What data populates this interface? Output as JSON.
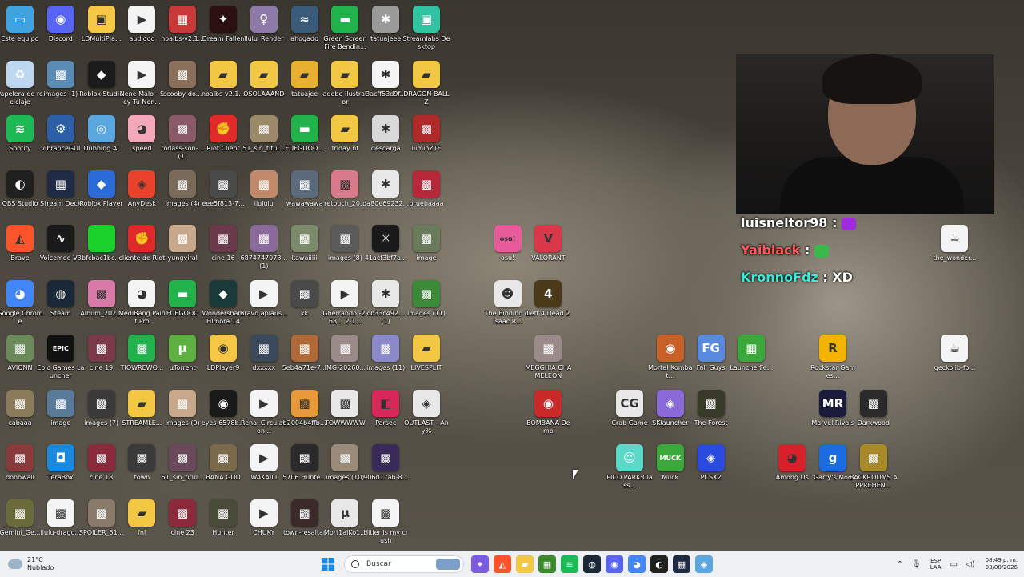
{
  "desktop_icons": [
    {
      "label": "Este equipo",
      "color": "#3fa3e0",
      "glyph": "▭",
      "col": 0,
      "row": 0
    },
    {
      "label": "Discord",
      "color": "#5865f2",
      "glyph": "◉",
      "col": 1,
      "row": 0
    },
    {
      "label": "LDMultiPla...",
      "color": "#f6c744",
      "glyph": "▣",
      "col": 2,
      "row": 0
    },
    {
      "label": "audiooo",
      "color": "#f4f4f4",
      "glyph": "▶",
      "col": 3,
      "row": 0
    },
    {
      "label": "noalbs-v2.1...",
      "color": "#c8393a",
      "glyph": "▦",
      "col": 4,
      "row": 0
    },
    {
      "label": "Dream Fallen",
      "color": "#2a1010",
      "glyph": "✦",
      "col": 5,
      "row": 0
    },
    {
      "label": "llulu_Render",
      "color": "#8e7aa8",
      "glyph": "♀",
      "col": 6,
      "row": 0
    },
    {
      "label": "ahogado",
      "color": "#3a5b7a",
      "glyph": "≈",
      "col": 7,
      "row": 0
    },
    {
      "label": "Green Screen Fire Bendin...",
      "color": "#22b24c",
      "glyph": "▬",
      "col": 8,
      "row": 0
    },
    {
      "label": "tatuajeee",
      "color": "#9a9a9a",
      "glyph": "✱",
      "col": 9,
      "row": 0
    },
    {
      "label": "Streamlabs Desktop",
      "color": "#31c3a2",
      "glyph": "▣",
      "col": 10,
      "row": 0
    },
    {
      "label": "Papelera de reciclaje",
      "color": "#bcd7ef",
      "glyph": "♻",
      "col": 0,
      "row": 1
    },
    {
      "label": "images (1)",
      "color": "#5a8bb5",
      "glyph": "▩",
      "col": 1,
      "row": 1
    },
    {
      "label": "Roblox Studio",
      "color": "#1b1b1b",
      "glyph": "◆",
      "col": 2,
      "row": 1
    },
    {
      "label": "Nene Malo - Sey Tu Nen...",
      "color": "#f4f4f4",
      "glyph": "▶",
      "col": 3,
      "row": 1
    },
    {
      "label": "scooby-do...",
      "color": "#8a6f5a",
      "glyph": "▩",
      "col": 4,
      "row": 1
    },
    {
      "label": "noalbs-v2.1...",
      "color": "#f2c744",
      "glyph": "▰",
      "col": 5,
      "row": 1
    },
    {
      "label": "OSOLAAAND",
      "color": "#f2c744",
      "glyph": "▰",
      "col": 6,
      "row": 1
    },
    {
      "label": "tatuajee",
      "color": "#e8b030",
      "glyph": "▰",
      "col": 7,
      "row": 1
    },
    {
      "label": "adobe ilustrator",
      "color": "#f2c744",
      "glyph": "▰",
      "col": 8,
      "row": 1
    },
    {
      "label": "3acff53d9f...",
      "color": "#f4f4f4",
      "glyph": "✱",
      "col": 9,
      "row": 1
    },
    {
      "label": "DRAGON BALL Z",
      "color": "#f2c744",
      "glyph": "▰",
      "col": 10,
      "row": 1
    },
    {
      "label": "Spotify",
      "color": "#1db954",
      "glyph": "≋",
      "col": 0,
      "row": 2
    },
    {
      "label": "vibranceGUI",
      "color": "#2d5fa8",
      "glyph": "⚙",
      "col": 1,
      "row": 2
    },
    {
      "label": "Dubbing AI",
      "color": "#5aa7e0",
      "glyph": "◎",
      "col": 2,
      "row": 2
    },
    {
      "label": "speed",
      "color": "#f2a8b8",
      "glyph": "◕",
      "col": 3,
      "row": 2
    },
    {
      "label": "todass-son-... (1)",
      "color": "#8a5a6a",
      "glyph": "▩",
      "col": 4,
      "row": 2
    },
    {
      "label": "Riot Client",
      "color": "#e02a2a",
      "glyph": "✊",
      "col": 5,
      "row": 2
    },
    {
      "label": "51_sin_titul...",
      "color": "#9a8a6a",
      "glyph": "▩",
      "col": 6,
      "row": 2
    },
    {
      "label": "FUEGOOO...",
      "color": "#22b24c",
      "glyph": "▬",
      "col": 7,
      "row": 2
    },
    {
      "label": "friday nf",
      "color": "#f2c744",
      "glyph": "▰",
      "col": 8,
      "row": 2
    },
    {
      "label": "descarga",
      "color": "#d8d8d8",
      "glyph": "✱",
      "col": 9,
      "row": 2
    },
    {
      "label": "iiiminZTF",
      "color": "#b02a2a",
      "glyph": "▩",
      "col": 10,
      "row": 2
    },
    {
      "label": "OBS Studio",
      "color": "#202020",
      "glyph": "◐",
      "col": 0,
      "row": 3
    },
    {
      "label": "Stream Deck",
      "color": "#1f2a44",
      "glyph": "▦",
      "col": 1,
      "row": 3
    },
    {
      "label": "Roblox Player",
      "color": "#2a6bd8",
      "glyph": "◆",
      "col": 2,
      "row": 3
    },
    {
      "label": "AnyDesk",
      "color": "#e8412c",
      "glyph": "◈",
      "col": 3,
      "row": 3
    },
    {
      "label": "images (4)",
      "color": "#7a6a5a",
      "glyph": "▩",
      "col": 4,
      "row": 3
    },
    {
      "label": "eee5f813-7...",
      "color": "#4a4a4a",
      "glyph": "▩",
      "col": 5,
      "row": 3
    },
    {
      "label": "ilululu",
      "color": "#c08a6a",
      "glyph": "▩",
      "col": 6,
      "row": 3
    },
    {
      "label": "wawawawa",
      "color": "#5a6a7a",
      "glyph": "▩",
      "col": 7,
      "row": 3
    },
    {
      "label": "retouch_20...",
      "color": "#d87a8a",
      "glyph": "▩",
      "col": 8,
      "row": 3
    },
    {
      "label": "da80e69232...",
      "color": "#e8e8e8",
      "glyph": "✱",
      "col": 9,
      "row": 3
    },
    {
      "label": "pruebaaaa",
      "color": "#b8283a",
      "glyph": "▩",
      "col": 10,
      "row": 3
    },
    {
      "label": "Brave",
      "color": "#fb542b",
      "glyph": "◭",
      "col": 0,
      "row": 4
    },
    {
      "label": "Voicemod V3",
      "color": "#1a1a1a",
      "glyph": "∿",
      "col": 1,
      "row": 4
    },
    {
      "label": "bfcbac1bc...",
      "color": "#19d12a",
      "glyph": "",
      "col": 2,
      "row": 4
    },
    {
      "label": "cliente de Riot",
      "color": "#e02a2a",
      "glyph": "✊",
      "col": 3,
      "row": 4
    },
    {
      "label": "yungviral",
      "color": "#c8a88a",
      "glyph": "▩",
      "col": 4,
      "row": 4
    },
    {
      "label": "cine 16",
      "color": "#6a3a4a",
      "glyph": "▩",
      "col": 5,
      "row": 4
    },
    {
      "label": "6874747073... (1)",
      "color": "#8a6a9a",
      "glyph": "▩",
      "col": 6,
      "row": 4
    },
    {
      "label": "kawaiiiii",
      "color": "#7a8a6a",
      "glyph": "▩",
      "col": 7,
      "row": 4
    },
    {
      "label": "images (8)",
      "color": "#5a5a5a",
      "glyph": "▩",
      "col": 8,
      "row": 4
    },
    {
      "label": "41acf3bf7a...",
      "color": "#1a1a1a",
      "glyph": "✳",
      "col": 9,
      "row": 4
    },
    {
      "label": "image",
      "color": "#6a7a5a",
      "glyph": "▩",
      "col": 10,
      "row": 4
    },
    {
      "label": "Google Chrome",
      "color": "#4285f4",
      "glyph": "◕",
      "col": 0,
      "row": 5
    },
    {
      "label": "Steam",
      "color": "#1b2838",
      "glyph": "◍",
      "col": 1,
      "row": 5
    },
    {
      "label": "Album_202...",
      "color": "#d87aa8",
      "glyph": "▩",
      "col": 2,
      "row": 5
    },
    {
      "label": "MediBang Paint Pro",
      "color": "#f4f4f4",
      "glyph": "◕",
      "col": 3,
      "row": 5
    },
    {
      "label": "FUEGOOO",
      "color": "#22b24c",
      "glyph": "▬",
      "col": 4,
      "row": 5
    },
    {
      "label": "Wondershare Filmora 14",
      "color": "#1a3a3a",
      "glyph": "◆",
      "col": 5,
      "row": 5
    },
    {
      "label": "Bravo aplaus...",
      "color": "#f4f4f4",
      "glyph": "▶",
      "col": 6,
      "row": 5
    },
    {
      "label": "kk",
      "color": "#4a4a4a",
      "glyph": "▩",
      "col": 7,
      "row": 5
    },
    {
      "label": "Gherrando -2-68... 2-1...",
      "color": "#f4f4f4",
      "glyph": "▶",
      "col": 8,
      "row": 5
    },
    {
      "label": "cb33c492... (1)",
      "color": "#e8e8e8",
      "glyph": "✱",
      "col": 9,
      "row": 5
    },
    {
      "label": "images (11)",
      "color": "#3a8a3a",
      "glyph": "▩",
      "col": 10,
      "row": 5
    },
    {
      "label": "AVIONN",
      "color": "#6a8a5a",
      "glyph": "▩",
      "col": 0,
      "row": 6
    },
    {
      "label": "Epic Games Launcher",
      "color": "#111111",
      "glyph": "EPIC",
      "col": 1,
      "row": 6
    },
    {
      "label": "cine 19",
      "color": "#7a3a4a",
      "glyph": "▩",
      "col": 2,
      "row": 6
    },
    {
      "label": "TIOWREWO...",
      "color": "#22b24c",
      "glyph": "▩",
      "col": 3,
      "row": 6
    },
    {
      "label": "µTorrent",
      "color": "#5fb043",
      "glyph": "µ",
      "col": 4,
      "row": 6
    },
    {
      "label": "LDPlayer9",
      "color": "#f6c744",
      "glyph": "◉",
      "col": 5,
      "row": 6
    },
    {
      "label": "dxxxxx",
      "color": "#3a4a5a",
      "glyph": "▩",
      "col": 6,
      "row": 6
    },
    {
      "label": "5eb4a71e-7...",
      "color": "#b06a3a",
      "glyph": "▩",
      "col": 7,
      "row": 6
    },
    {
      "label": "IMG-20260...",
      "color": "#9a8a8a",
      "glyph": "▩",
      "col": 8,
      "row": 6
    },
    {
      "label": "images (11)",
      "color": "#8a8aca",
      "glyph": "▩",
      "col": 9,
      "row": 6
    },
    {
      "label": "LIVESPLIT",
      "color": "#f2c744",
      "glyph": "▰",
      "col": 10,
      "row": 6
    },
    {
      "label": "cabaaa",
      "color": "#8a7a5a",
      "glyph": "▩",
      "col": 0,
      "row": 7
    },
    {
      "label": "image",
      "color": "#5a7a9a",
      "glyph": "▩",
      "col": 1,
      "row": 7
    },
    {
      "label": "images (7)",
      "color": "#3a3a3a",
      "glyph": "▩",
      "col": 2,
      "row": 7
    },
    {
      "label": "STREAMLE...",
      "color": "#f2c744",
      "glyph": "▰",
      "col": 3,
      "row": 7
    },
    {
      "label": "images (9)",
      "color": "#c8a88a",
      "glyph": "▩",
      "col": 4,
      "row": 7
    },
    {
      "label": "eyes-6578b...",
      "color": "#1a1a1a",
      "glyph": "◉",
      "col": 5,
      "row": 7
    },
    {
      "label": "Renai Circulation...",
      "color": "#f4f4f4",
      "glyph": "▶",
      "col": 6,
      "row": 7
    },
    {
      "label": "d2004b4ffb...",
      "color": "#e89a3a",
      "glyph": "▩",
      "col": 7,
      "row": 7
    },
    {
      "label": "TOWWWWW",
      "color": "#e8e8e8",
      "glyph": "▩",
      "col": 8,
      "row": 7
    },
    {
      "label": "Parsec",
      "color": "#d8285a",
      "glyph": "◧",
      "col": 9,
      "row": 7
    },
    {
      "label": "OUTLAST - Any%",
      "color": "#e8e8e8",
      "glyph": "◈",
      "col": 10,
      "row": 7
    },
    {
      "label": "donowall",
      "color": "#8a3a3a",
      "glyph": "▩",
      "col": 0,
      "row": 8
    },
    {
      "label": "TeraBox",
      "color": "#1a8ae0",
      "glyph": "◘",
      "col": 1,
      "row": 8
    },
    {
      "label": "cine 18",
      "color": "#8a2a3a",
      "glyph": "▩",
      "col": 2,
      "row": 8
    },
    {
      "label": "town",
      "color": "#3a3a3a",
      "glyph": "▩",
      "col": 3,
      "row": 8
    },
    {
      "label": "51_sin_titul...",
      "color": "#6a4a5a",
      "glyph": "▩",
      "col": 4,
      "row": 8
    },
    {
      "label": "BANA GOD",
      "color": "#7a6a4a",
      "glyph": "▩",
      "col": 5,
      "row": 8
    },
    {
      "label": "WAKAIIII",
      "color": "#f4f4f4",
      "glyph": "▶",
      "col": 6,
      "row": 8
    },
    {
      "label": "5706.Hunte...",
      "color": "#2a2a2a",
      "glyph": "▩",
      "col": 7,
      "row": 8
    },
    {
      "label": "images (10)",
      "color": "#9a8a7a",
      "glyph": "▩",
      "col": 8,
      "row": 8
    },
    {
      "label": "906d17ab-8...",
      "color": "#3a2a5a",
      "glyph": "▩",
      "col": 9,
      "row": 8
    },
    {
      "label": "Gemini_Ge...",
      "color": "#6a6a3a",
      "glyph": "▩",
      "col": 0,
      "row": 9
    },
    {
      "label": "ilulu-drago...",
      "color": "#f4f4f4",
      "glyph": "▩",
      "col": 1,
      "row": 9
    },
    {
      "label": "SPOILER_51...",
      "color": "#8a7a6a",
      "glyph": "▩",
      "col": 2,
      "row": 9
    },
    {
      "label": "fnf",
      "color": "#f2c744",
      "glyph": "▰",
      "col": 3,
      "row": 9
    },
    {
      "label": "cine 23",
      "color": "#8a2a3a",
      "glyph": "▩",
      "col": 4,
      "row": 9
    },
    {
      "label": "Hunter",
      "color": "#4a4a3a",
      "glyph": "▩",
      "col": 5,
      "row": 9
    },
    {
      "label": "CHUKY",
      "color": "#f4f4f4",
      "glyph": "▶",
      "col": 6,
      "row": 9
    },
    {
      "label": "town-resaltar",
      "color": "#3a2a2a",
      "glyph": "▩",
      "col": 7,
      "row": 9
    },
    {
      "label": "Mort1aiKo1...",
      "color": "#e8e8e8",
      "glyph": "µ",
      "col": 8,
      "row": 9
    },
    {
      "label": "Hitler is my crush",
      "color": "#f4f4f4",
      "glyph": "▩",
      "col": 9,
      "row": 9
    },
    {
      "label": "osu!",
      "color": "#e85b9a",
      "glyph": "osu!",
      "col": 12,
      "row": 4
    },
    {
      "label": "VALORANT",
      "color": "#d8384a",
      "glyph": "V",
      "col": 13,
      "row": 4
    },
    {
      "label": "The Binding of Isaac R...",
      "color": "#e8e8e8",
      "glyph": "☻",
      "col": 12,
      "row": 5
    },
    {
      "label": "Left 4 Dead 2",
      "color": "#4a3a1a",
      "glyph": "4",
      "col": 13,
      "row": 5
    },
    {
      "label": "MEGGHIA CHAMELEON",
      "color": "#9a8a8a",
      "glyph": "▩",
      "col": 13,
      "row": 6
    },
    {
      "label": "BOMBANA Demo",
      "color": "#c82a2a",
      "glyph": "◉",
      "col": 13,
      "row": 7
    },
    {
      "label": "Mortal Kombat...",
      "color": "#c8602a",
      "glyph": "◉",
      "col": 16,
      "row": 6
    },
    {
      "label": "Fall Guys",
      "color": "#5a8ae0",
      "glyph": "FG",
      "col": 17,
      "row": 6
    },
    {
      "label": "LauncherFe...",
      "color": "#3aa83a",
      "glyph": "▦",
      "col": 18,
      "row": 6
    },
    {
      "label": "Rockstar Games...",
      "color": "#f2b400",
      "glyph": "R",
      "col": 20,
      "row": 6
    },
    {
      "label": "geckolib-fo...",
      "color": "#f4f4f4",
      "glyph": "☕",
      "col": 23,
      "row": 6
    },
    {
      "label": "Crab Game",
      "color": "#e8e8e8",
      "glyph": "CG",
      "col": 15,
      "row": 7
    },
    {
      "label": "SKlauncher",
      "color": "#8a6ad8",
      "glyph": "◈",
      "col": 16,
      "row": 7
    },
    {
      "label": "The Forest",
      "color": "#3a3a2a",
      "glyph": "▩",
      "col": 17,
      "row": 7
    },
    {
      "label": "Marvel Rivals",
      "color": "#1a1a3a",
      "glyph": "MR",
      "col": 20,
      "row": 7
    },
    {
      "label": "Darkwood",
      "color": "#2a2a2a",
      "glyph": "▩",
      "col": 21,
      "row": 7
    },
    {
      "label": "PICO PARK:Class...",
      "color": "#5ad8c8",
      "glyph": "☺",
      "col": 15,
      "row": 8
    },
    {
      "label": "Muck",
      "color": "#3aa83a",
      "glyph": "MUCK",
      "col": 16,
      "row": 8
    },
    {
      "label": "PCSX2",
      "color": "#2a4ae0",
      "glyph": "◈",
      "col": 17,
      "row": 8
    },
    {
      "label": "Among Us",
      "color": "#d8202a",
      "glyph": "◕",
      "col": 19,
      "row": 8
    },
    {
      "label": "Garry's Mod",
      "color": "#1a6ae0",
      "glyph": "g",
      "col": 20,
      "row": 8
    },
    {
      "label": "BACKROOMS APPREHEN...",
      "color": "#a88a2a",
      "glyph": "▩",
      "col": 21,
      "row": 8
    },
    {
      "label": "the_wonder...",
      "color": "#f4f4f4",
      "glyph": "☕",
      "col": 23,
      "row": 4
    }
  ],
  "chat": [
    {
      "user": "luisneltor98",
      "message": "",
      "color": "#ffffff"
    },
    {
      "user": "Yaiblack",
      "message": "",
      "color": "#ff5a5a"
    },
    {
      "user": "KronnoFdz",
      "message": "XD",
      "color": "#3ae8d8"
    }
  ],
  "taskbar": {
    "weather_temp": "21°C",
    "weather_desc": "Nublado",
    "search_placeholder": "Buscar",
    "apps": [
      {
        "name": "copilot-icon",
        "color": "#7a5ae0",
        "glyph": "✦"
      },
      {
        "name": "brave-icon",
        "color": "#fb542b",
        "glyph": "◭"
      },
      {
        "name": "file-explorer-icon",
        "color": "#f2c744",
        "glyph": "▰"
      },
      {
        "name": "minecraft-icon",
        "color": "#3a8a2a",
        "glyph": "▦"
      },
      {
        "name": "spotify-icon",
        "color": "#1db954",
        "glyph": "≋"
      },
      {
        "name": "steam-icon",
        "color": "#1b2838",
        "glyph": "◍"
      },
      {
        "name": "discord-icon",
        "color": "#5865f2",
        "glyph": "◉"
      },
      {
        "name": "chrome-icon",
        "color": "#4285f4",
        "glyph": "◕"
      },
      {
        "name": "obs-icon",
        "color": "#202020",
        "glyph": "◐"
      },
      {
        "name": "stream-deck-icon",
        "color": "#1f2a44",
        "glyph": "▦"
      },
      {
        "name": "dubbing-ai-icon",
        "color": "#5aa7e0",
        "glyph": "◈"
      }
    ],
    "lang_line1": "ESP",
    "lang_line2": "LAA",
    "time": "08:49 p. m.",
    "date": "03/08/2026"
  }
}
